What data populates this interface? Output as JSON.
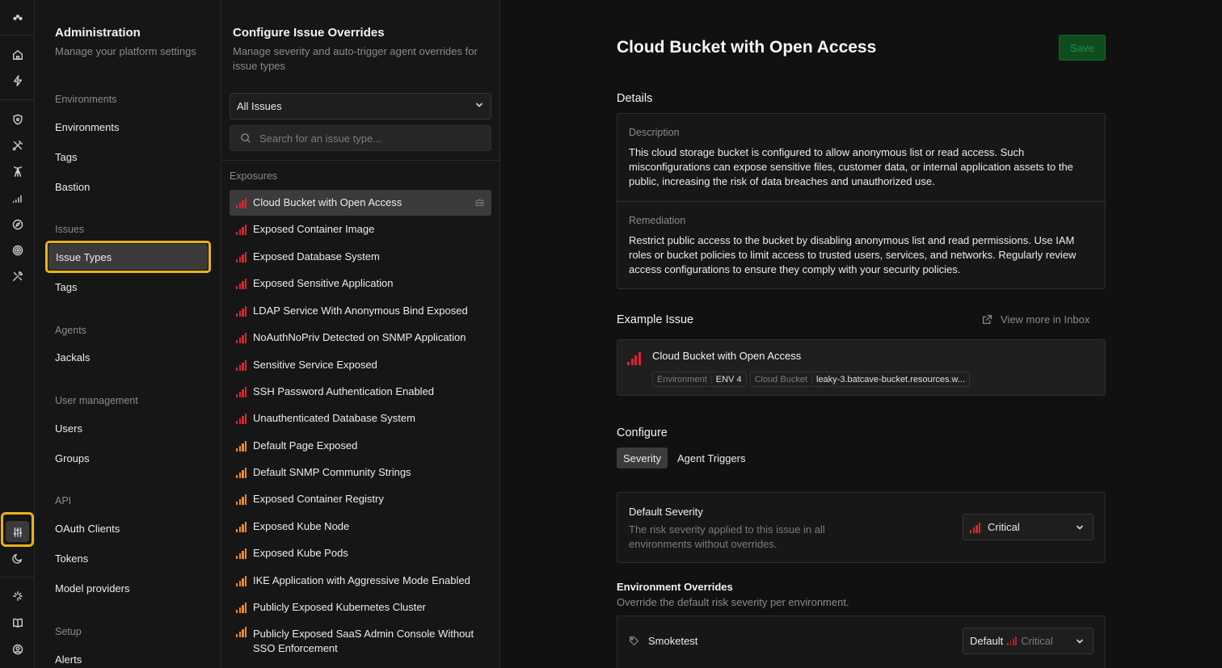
{
  "rail": {
    "icons": [
      "logo-icon",
      "home-icon",
      "lightning-icon",
      "shield-icon",
      "satellite-icon",
      "tower-icon",
      "signal-icon",
      "compass-icon",
      "target-icon",
      "tools-icon",
      "sliders-icon",
      "moon-icon",
      "sparkle-icon",
      "book-icon",
      "user-circle-icon"
    ]
  },
  "admin": {
    "title": "Administration",
    "subtitle": "Manage your platform settings",
    "sections": [
      {
        "label": "Environments",
        "items": [
          "Environments",
          "Tags",
          "Bastion"
        ]
      },
      {
        "label": "Issues",
        "items": [
          "Issue Types",
          "Tags"
        ]
      },
      {
        "label": "Agents",
        "items": [
          "Jackals"
        ]
      },
      {
        "label": "User management",
        "items": [
          "Users",
          "Groups"
        ]
      },
      {
        "label": "API",
        "items": [
          "OAuth Clients",
          "Tokens",
          "Model providers"
        ]
      },
      {
        "label": "Setup",
        "items": [
          "Alerts"
        ]
      }
    ],
    "active_item": "Issue Types"
  },
  "list": {
    "title": "Configure Issue Overrides",
    "subtitle": "Manage severity and auto-trigger agent overrides for issue types",
    "filter_value": "All Issues",
    "search_placeholder": "Search for an issue type...",
    "section": "Exposures",
    "items": [
      {
        "label": "Cloud Bucket with Open Access",
        "severity": "critical"
      },
      {
        "label": "Exposed Container Image",
        "severity": "critical"
      },
      {
        "label": "Exposed Database System",
        "severity": "critical"
      },
      {
        "label": "Exposed Sensitive Application",
        "severity": "critical"
      },
      {
        "label": "LDAP Service With Anonymous Bind Exposed",
        "severity": "critical"
      },
      {
        "label": "NoAuthNoPriv Detected on SNMP Application",
        "severity": "critical"
      },
      {
        "label": "Sensitive Service Exposed",
        "severity": "critical"
      },
      {
        "label": "SSH Password Authentication Enabled",
        "severity": "critical"
      },
      {
        "label": "Unauthenticated Database System",
        "severity": "critical"
      },
      {
        "label": "Default Page Exposed",
        "severity": "high"
      },
      {
        "label": "Default SNMP Community Strings",
        "severity": "high"
      },
      {
        "label": "Exposed Container Registry",
        "severity": "high"
      },
      {
        "label": "Exposed Kube Node",
        "severity": "high"
      },
      {
        "label": "Exposed Kube Pods",
        "severity": "high"
      },
      {
        "label": "IKE Application with Aggressive Mode Enabled",
        "severity": "high"
      },
      {
        "label": "Publicly Exposed Kubernetes Cluster",
        "severity": "high"
      },
      {
        "label": "Publicly Exposed SaaS Admin Console Without SSO Enforcement",
        "severity": "high"
      }
    ]
  },
  "colors": {
    "critical": "#e0242b",
    "high": "#f08a24",
    "highlight": "#e8b21d"
  },
  "main": {
    "title": "Cloud Bucket with Open Access",
    "save_label": "Save",
    "details_heading": "Details",
    "description_label": "Description",
    "description_text": "This cloud storage bucket is configured to allow anonymous list or read access. Such misconfigurations can expose sensitive files, customer data, or internal application assets to the public, increasing the risk of data breaches and unauthorized use.",
    "remediation_label": "Remediation",
    "remediation_text": "Restrict public access to the bucket by disabling anonymous list and read permissions. Use IAM roles or bucket policies to limit access to trusted users, services, and networks. Regularly review access configurations to ensure they comply with your security policies.",
    "example_heading": "Example Issue",
    "view_more": "View more in Inbox",
    "example": {
      "title": "Cloud Bucket with Open Access",
      "tags": [
        {
          "key": "Environment",
          "value": "ENV 4"
        },
        {
          "key": "Cloud Bucket",
          "value": "leaky-3.batcave-bucket.resources.w..."
        }
      ]
    },
    "configure_heading": "Configure",
    "tabs": [
      "Severity",
      "Agent Triggers"
    ],
    "active_tab": "Severity",
    "default_severity": {
      "label": "Default Severity",
      "description": "The risk severity applied to this issue in all environments without overrides.",
      "value": "Critical"
    },
    "env_overrides": {
      "heading": "Environment Overrides",
      "description": "Override the default risk severity per environment.",
      "rows": [
        {
          "name": "Smoketest",
          "value_prefix": "Default",
          "value": "Critical"
        }
      ]
    }
  }
}
